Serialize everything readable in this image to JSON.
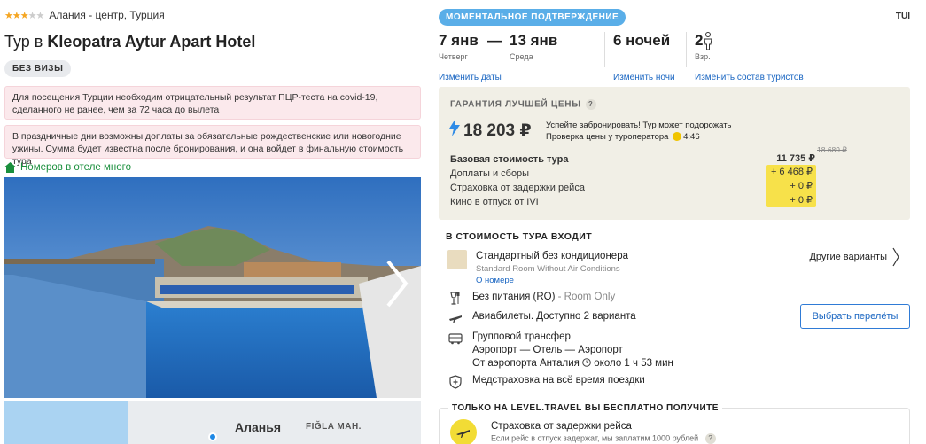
{
  "hotel": {
    "stars_filled": 3,
    "stars_total": 5,
    "location": "Алания - центр, Турция",
    "title_prefix": "Тур в ",
    "title_name": "Kleopatra Aytur Apart Hotel",
    "visa_badge": "БЕЗ ВИЗЫ"
  },
  "alerts": [
    "Для посещения Турции необходим отрицательный результат ПЦР-теста на covid-19, сделанного не ранее, чем за 72 часа до вылета",
    "В праздничные дни возможны доплаты за обязательные рождественские или новогодние ужины. Сумма будет известна после бронирования, и она войдет в финальную стоимость тура"
  ],
  "rooms_note": "Номеров в отеле много",
  "map": {
    "city": "Аланья",
    "district": "FIĞLA MAH."
  },
  "confirm_badge": "МОМЕНТАЛЬНОЕ ПОДТВЕРЖДЕНИЕ",
  "operator": "TUI",
  "dates": {
    "from": "7 янв",
    "from_day": "Четверг",
    "dash": "—",
    "to": "13 янв",
    "to_day": "Среда",
    "nights": "6 ночей",
    "adults": "2",
    "adults_label": "Взр."
  },
  "links": {
    "change_dates": "Изменить даты",
    "change_nights": "Изменить ночи",
    "change_tourists": "Изменить состав туристов"
  },
  "price": {
    "guarantee": "ГАРАНТИЯ ЛУЧШЕЙ ЦЕНЫ",
    "guarantee_q": "?",
    "total": "18 203 ₽",
    "hurry_line1": "Успейте забронировать! Тур может подорожать",
    "hurry_line2": "Проверка цены у туроператора",
    "timer": "4:46",
    "base_label": "Базовая стоимость тура",
    "base_value": "11 735 ₽",
    "base_old": "18 689 ₽",
    "fees_label": "Доплаты и сборы",
    "fees_value": "+ 6 468 ₽",
    "delay_ins_label": "Страховка от задержки рейса",
    "delay_ins_value": "+ 0 ₽",
    "kino_label": "Кино в отпуск от IVI",
    "kino_value": "+ 0 ₽"
  },
  "included": {
    "title": "В СТОИМОСТЬ ТУРА ВХОДИТ",
    "room_name": "Стандартный без кондиционера",
    "room_sub": "Standard Room Without Air Conditions",
    "room_link": "О номере",
    "other_options": "Другие варианты",
    "meal": "Без питания (RO)",
    "meal_sub": " - Room Only",
    "flights": "Авиабилеты. Доступно 2 варианта",
    "choose_flights": "Выбрать перелёты",
    "transfer": "Групповой трансфер",
    "transfer_route": "Аэропорт — Отель — Аэропорт",
    "transfer_from": "От аэропорта Анталия",
    "transfer_time": "около 1 ч 53 мин",
    "med_ins": "Медстраховка на всё время поездки"
  },
  "bonus": {
    "title": "ТОЛЬКО НА LEVEL.TRAVEL ВЫ БЕСПЛАТНО ПОЛУЧИТЕ",
    "main": "Страховка от задержки рейса",
    "sub": "Если рейс в отпуск задержат, мы заплатим 1000 рублей"
  },
  "colors": {
    "link": "#1a66c2",
    "badge_blue": "#5aaee8",
    "green": "#1a8f3d",
    "alert_bg": "#fbe9ec",
    "price_panel": "#f1efe6",
    "highlight": "#f7e14a"
  }
}
